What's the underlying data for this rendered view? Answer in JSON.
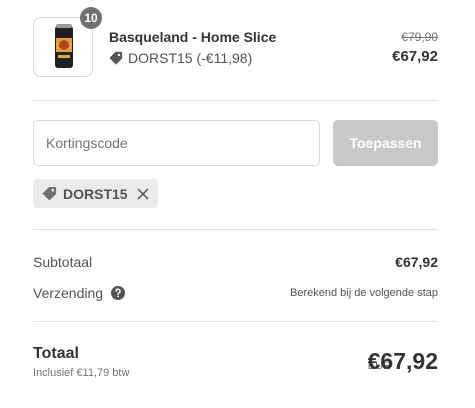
{
  "product": {
    "quantity": "10",
    "name": "Basqueland - Home Slice",
    "discount_line": "DORST15 (-€11,98)",
    "original_price": "€79,90",
    "price": "€67,92"
  },
  "discount": {
    "input_placeholder": "Kortingscode",
    "apply_label": "Toepassen",
    "applied_code": "DORST15"
  },
  "totals": {
    "subtotal_label": "Subtotaal",
    "subtotal_value": "€67,92",
    "shipping_label": "Verzending",
    "shipping_value": "Berekend bij de volgende stap",
    "total_label": "Totaal",
    "tax_note": "Inclusief €11,79 btw",
    "currency": "EUR",
    "total_value": "€67,92"
  },
  "colors": {
    "apply_button_disabled": "#c8c8c8",
    "quantity_badge": "#717171",
    "chip_background": "#ebebeb"
  },
  "icons": {
    "discount_tag": "tag-icon",
    "remove_code": "close-icon",
    "shipping_help": "question-circle-icon"
  }
}
